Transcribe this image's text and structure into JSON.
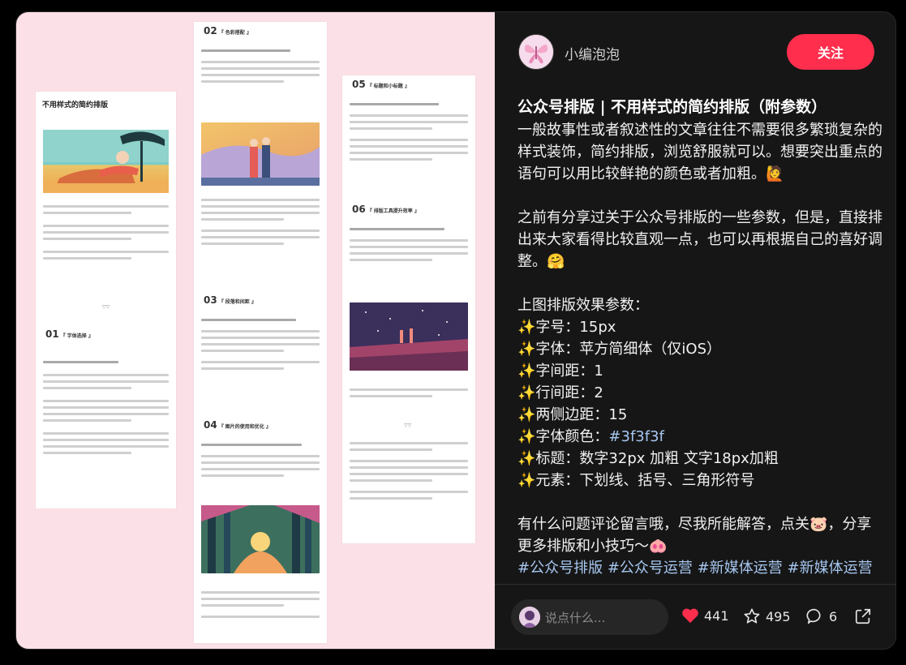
{
  "author": {
    "name": "小编泡泡",
    "avatar_icon": "butterfly-avatar-icon"
  },
  "follow_label": "关注",
  "post": {
    "title": "公众号排版 | 不用样式的简约排版（附参数）",
    "para1": "一般故事性或者叙述性的文章往往不需要很多繁琐复杂的样式装饰，简约排版，浏览舒服就可以。想要突出重点的语句可以用比较鲜艳的颜色或者加粗。🙋",
    "para2": "之前有分享过关于公众号排版的一些参数，但是，直接排出来大家看得比较直观一点，也可以再根据自己的喜好调整。🤗",
    "params_title": "上图排版效果参数：",
    "params": [
      "字号：15px",
      "字体：苹方简细体（仅iOS）",
      "字间距：1",
      "行间距：2",
      "两侧边距：15",
      "字体颜色：",
      "标题：数字32px 加粗  文字18px加粗",
      "元素：下划线、括号、三角形符号"
    ],
    "color_link": "#3f3f3f",
    "para3": "有什么问题评论留言哦，尽我所能解答，点关🐷，分享更多排版和小技巧～🐽",
    "tags": [
      "#公众号排版",
      "#公众号运营",
      "#新媒体运营",
      "#新媒体运营"
    ],
    "spark_icon": "✨"
  },
  "comment_placeholder": "说点什么...",
  "stats": {
    "likes": "441",
    "stars": "495",
    "comments": "6"
  },
  "preview": {
    "page1_title": "不用样式的简约排版",
    "sec01": "01",
    "sec01_label": "『 字体选择 』",
    "sec02": "02",
    "sec02_label": "『 色彩搭配 』",
    "sec03": "03",
    "sec03_label": "『 段落和间距 』",
    "sec04": "04",
    "sec04_label": "『 图片的使用和优化 』",
    "sec05": "05",
    "sec05_label": "『 标题和小标题 』",
    "sec06": "06",
    "sec06_label": "『 排版工具提升效率 』",
    "divider_mark": "▽▽"
  },
  "colors": {
    "accent": "#ff2e4d",
    "link": "#a6c6ef",
    "heart": "#ff2e4d",
    "left_bg": "#fbe1e7"
  }
}
